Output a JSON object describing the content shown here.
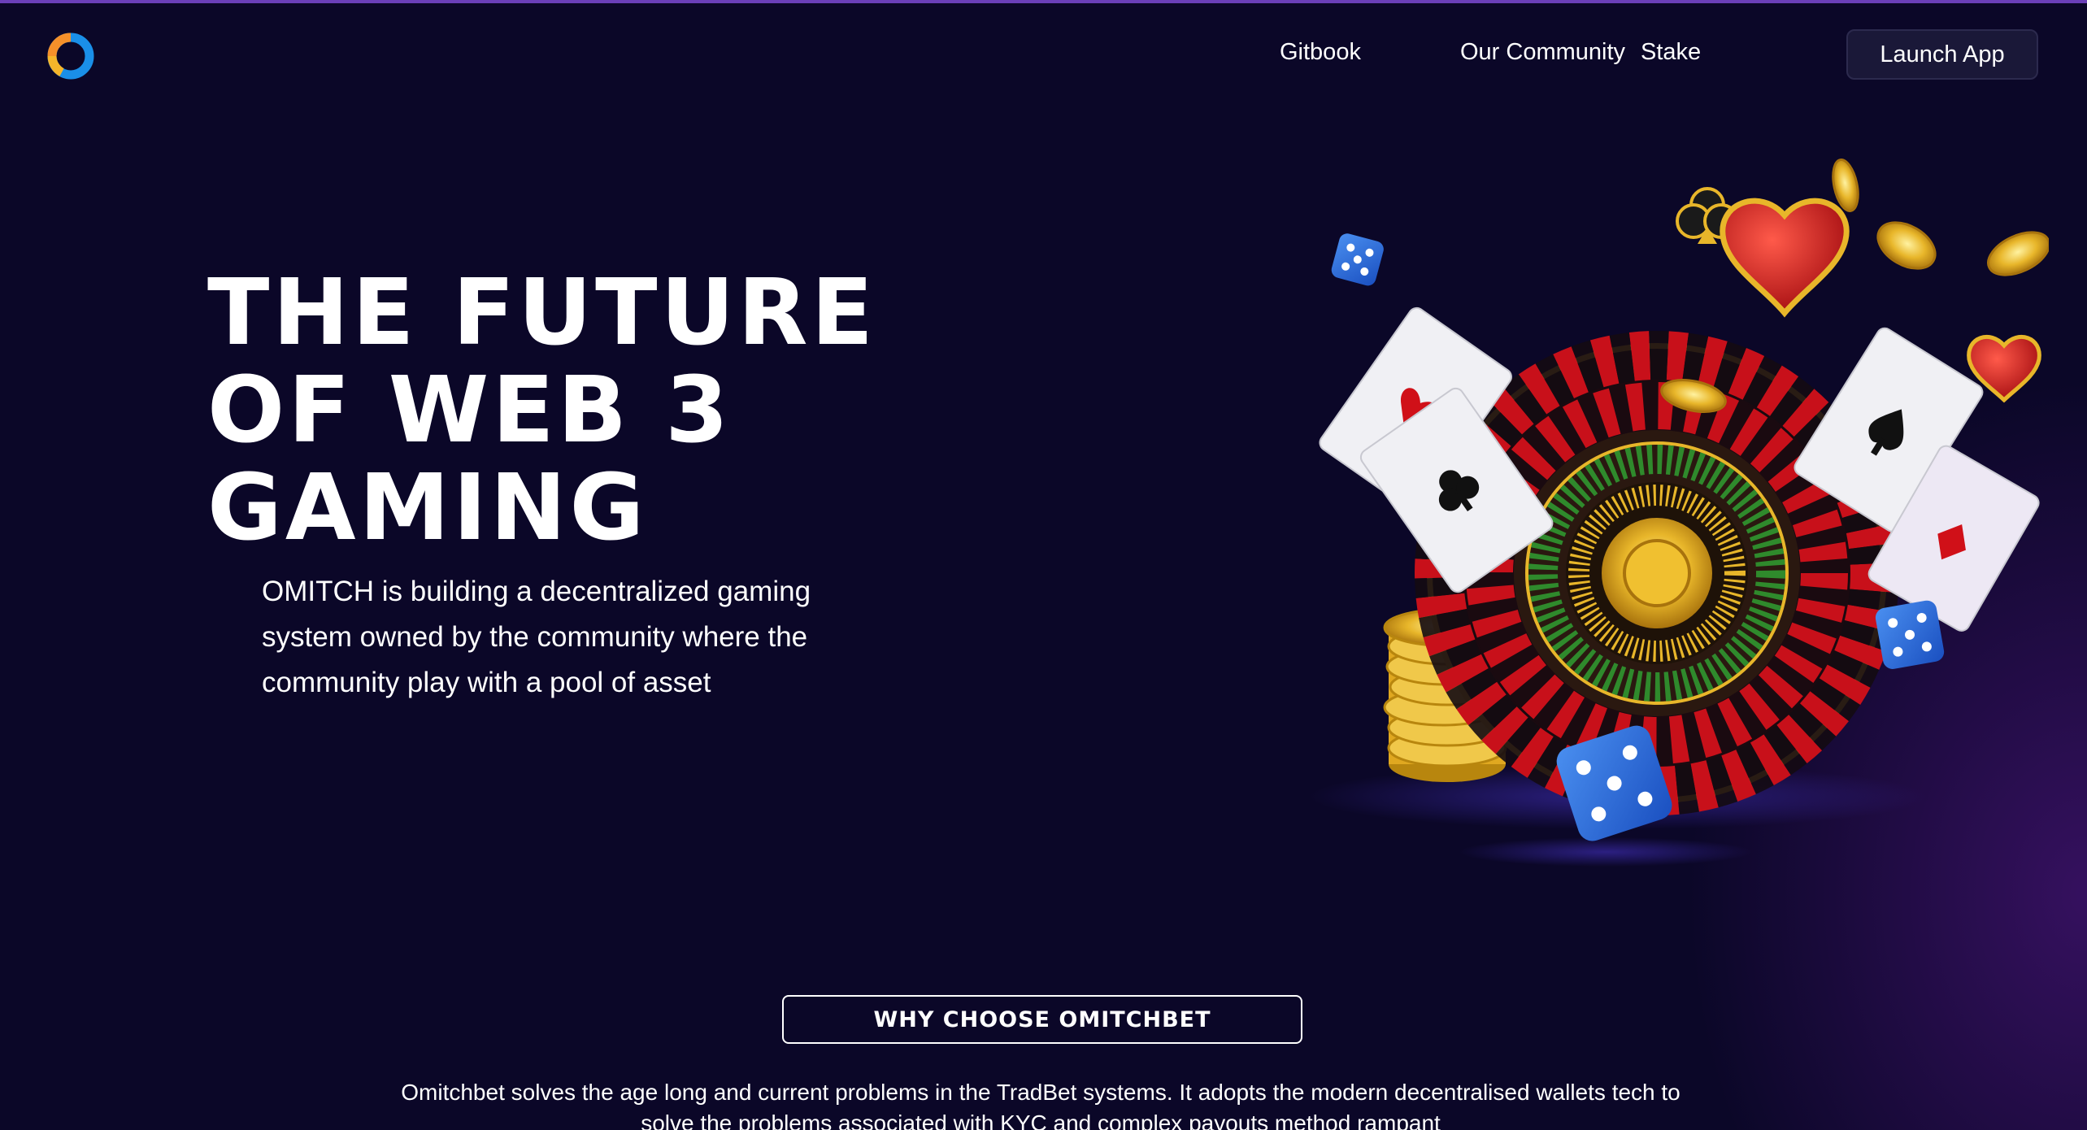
{
  "header": {
    "logo_icon": "omitch-ring-logo-icon",
    "nav": [
      {
        "label": "Gitbook"
      },
      {
        "label": "Our Community"
      },
      {
        "label": "Stake"
      }
    ],
    "launch_label": "Launch App"
  },
  "hero": {
    "title_lines": [
      "THE FUTURE",
      "OF WEB 3",
      "GAMING"
    ],
    "description": "OMITCH is building a decentralized gaming system owned by the community where the community play with a pool of asset",
    "illustration_icon": "casino-roulette-illustration"
  },
  "why": {
    "button_label": "WHY CHOOSE OMITCHBET",
    "text": "Omitchbet solves the age long and current problems in the TradBet systems. It adopts the modern decentralised wallets tech to solve the problems associated with KYC and complex payouts method rampant"
  },
  "colors": {
    "background": "#0b0728",
    "accent_purple": "#6b3fb8",
    "launch_bg": "#1a1838",
    "logo_orange": "#f5902a",
    "logo_blue": "#1a8fe8"
  }
}
